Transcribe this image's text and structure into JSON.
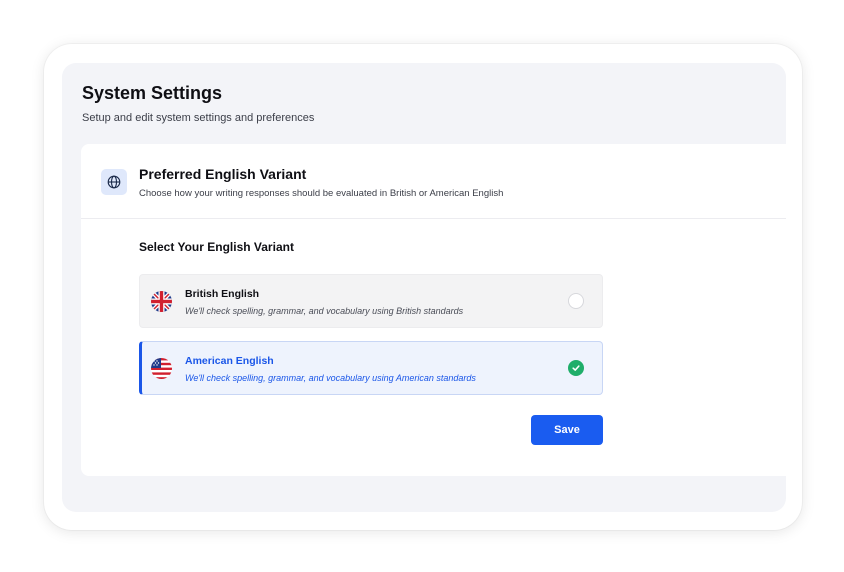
{
  "page": {
    "title": "System Settings",
    "subtitle": "Setup and edit system settings and preferences"
  },
  "section": {
    "icon": "globe-icon",
    "title": "Preferred English Variant",
    "description": "Choose how your writing responses should be evaluated in British or American English"
  },
  "variant_label": "Select Your English Variant",
  "options": [
    {
      "name": "British English",
      "description": "We'll check spelling, grammar, and vocabulary using British standards",
      "icon": "uk-flag-icon",
      "selected": false
    },
    {
      "name": "American English",
      "description": "We'll check spelling, grammar, and vocabulary using American standards",
      "icon": "us-flag-icon",
      "selected": true
    }
  ],
  "save_label": "Save",
  "colors": {
    "accent": "#1a5cf0",
    "selected_text": "#1a56e8",
    "check": "#1fae6a",
    "selected_bg": "#eef3fd"
  }
}
